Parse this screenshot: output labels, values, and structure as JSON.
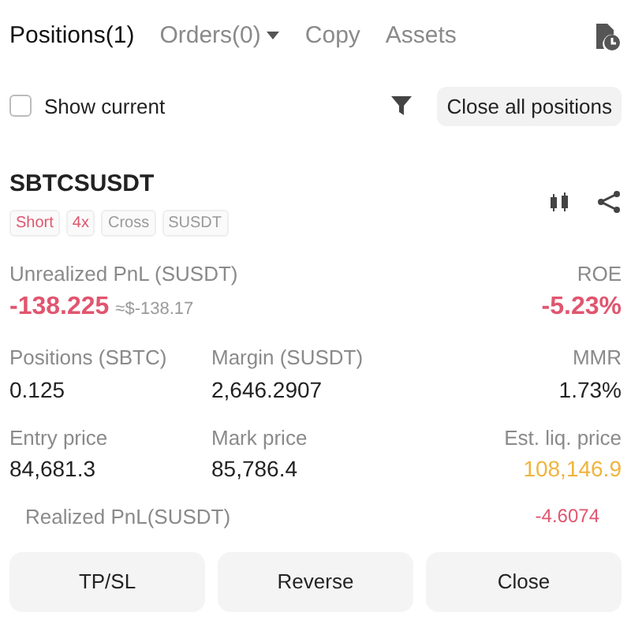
{
  "tabs": [
    {
      "label": "Positions(1)",
      "selected": true,
      "dropdown": false
    },
    {
      "label": "Orders(0)",
      "selected": false,
      "dropdown": true
    },
    {
      "label": "Copy",
      "selected": false,
      "dropdown": false
    },
    {
      "label": "Assets",
      "selected": false,
      "dropdown": false
    }
  ],
  "show_current": {
    "label": "Show current",
    "checked": false
  },
  "close_all_button": "Close all positions",
  "position": {
    "symbol": "SBTCSUSDT",
    "tags": [
      {
        "label": "Short",
        "color": "#e0566f"
      },
      {
        "label": "4x",
        "color": "#e0566f"
      },
      {
        "label": "Cross",
        "color": "#9a9a9a"
      },
      {
        "label": "SUSDT",
        "color": "#9a9a9a"
      }
    ],
    "unrealized_pnl": {
      "label": "Unrealized PnL (SUSDT)",
      "value": "-138.225",
      "approx": "≈$-138.17",
      "color": "#e0566f"
    },
    "roe": {
      "label": "ROE",
      "value": "-5.23%",
      "color": "#e0566f"
    },
    "stats": [
      {
        "label": "Positions (SBTC)",
        "value": "0.125",
        "color": "#222222"
      },
      {
        "label": "Margin (SUSDT)",
        "value": "2,646.2907",
        "color": "#222222"
      },
      {
        "label": "MMR",
        "value": "1.73%",
        "color": "#222222"
      },
      {
        "label": "Entry price",
        "value": "84,681.3",
        "color": "#222222"
      },
      {
        "label": "Mark price",
        "value": "85,786.4",
        "color": "#222222"
      },
      {
        "label": "Est. liq. price",
        "value": "108,146.9",
        "color": "#f0b43c"
      }
    ],
    "realized_pnl": {
      "label": "Realized PnL(SUSDT)",
      "value": "-4.6074",
      "color": "#e0566f"
    }
  },
  "buttons": [
    "TP/SL",
    "Reverse",
    "Close"
  ]
}
